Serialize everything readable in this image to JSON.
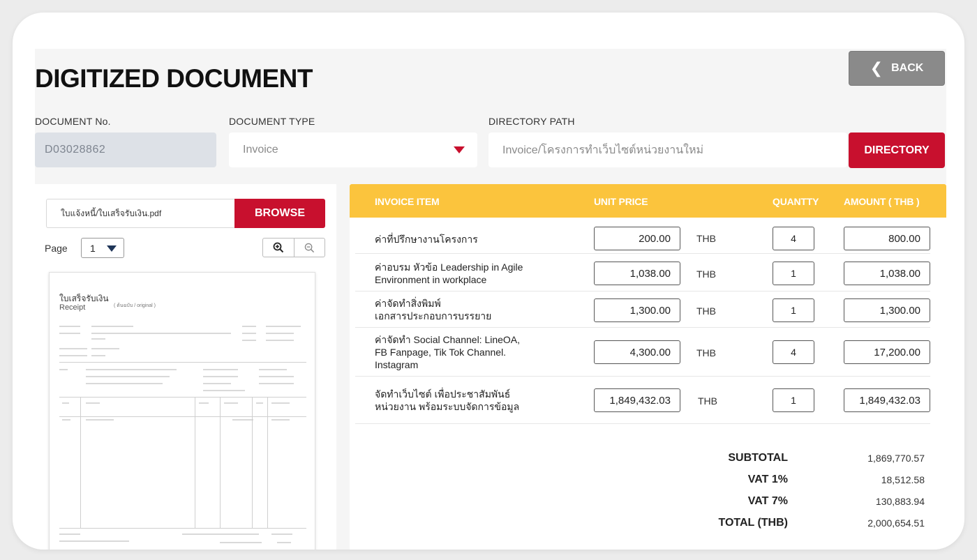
{
  "colors": {
    "accent_red": "#c8102e",
    "header_yellow": "#fbc43d",
    "back_gray": "#8a8a8a"
  },
  "header": {
    "title": "DIGITIZED DOCUMENT",
    "back_label": "BACK"
  },
  "fields": {
    "doc_no_label": "DOCUMENT No.",
    "doc_no_value": "D03028862",
    "doc_type_label": "DOCUMENT TYPE",
    "doc_type_value": "Invoice",
    "dir_label": "DIRECTORY PATH",
    "dir_value": "Invoice/โครงการทำเว็บไซต์หน่วยงานใหม่",
    "dir_button": "DIRECTORY"
  },
  "preview": {
    "file_name": "ใบแจ้งหนี้/ใบเสร็จรับเงิน.pdf",
    "browse_label": "BROWSE",
    "page_label": "Page",
    "page_value": "1",
    "doc_title_th": "ใบเสร็จรับเงิน",
    "doc_title_en": "Receipt",
    "doc_title_note": "( ต้นฉบับ / original )",
    "zoom_in_icon": "zoom-in-icon",
    "zoom_out_icon": "zoom-out-icon"
  },
  "invoice": {
    "headers": {
      "item": "INVOICE ITEM",
      "unit_price": "UNIT PRICE",
      "quantity": "QUANTTY",
      "amount": "AMOUNT ( THB )"
    },
    "currency": "THB",
    "rows": [
      {
        "desc1": "ค่าที่ปรึกษางานโครงการ",
        "desc2": "",
        "desc3": "",
        "unit_price": "200.00",
        "qty": "4",
        "amount": "800.00"
      },
      {
        "desc1": "ค่าอบรม หัวข้อ Leadership in Agile",
        "desc2": "Environment in workplace",
        "desc3": "",
        "unit_price": "1,038.00",
        "qty": "1",
        "amount": "1,038.00"
      },
      {
        "desc1": "ค่าจัดทำสิ่งพิมพ์",
        "desc2": "เอกสารประกอบการบรรยาย",
        "desc3": "",
        "unit_price": "1,300.00",
        "qty": "1",
        "amount": "1,300.00"
      },
      {
        "desc1": "ค่าจัดทำ Social Channel: LineOA,",
        "desc2": "FB Fanpage, Tik Tok Channel.",
        "desc3": "Instagram",
        "unit_price": "4,300.00",
        "qty": "4",
        "amount": "17,200.00"
      },
      {
        "desc1": "จัดทำเว็บไซต์ เพื่อประชาสัมพันธ์",
        "desc2": "หน่วยงาน พร้อมระบบจัดการข้อมูล",
        "desc3": "",
        "unit_price": "1,849,432.03",
        "qty": "1",
        "amount": "1,849,432.03"
      }
    ],
    "summary": {
      "subtotal_label": "SUBTOTAL",
      "subtotal": "1,869,770.57",
      "vat1_label": "VAT 1%",
      "vat1": "18,512.58",
      "vat7_label": "VAT 7%",
      "vat7": "130,883.94",
      "total_label": "TOTAL (THB)",
      "total": "2,000,654.51"
    }
  }
}
